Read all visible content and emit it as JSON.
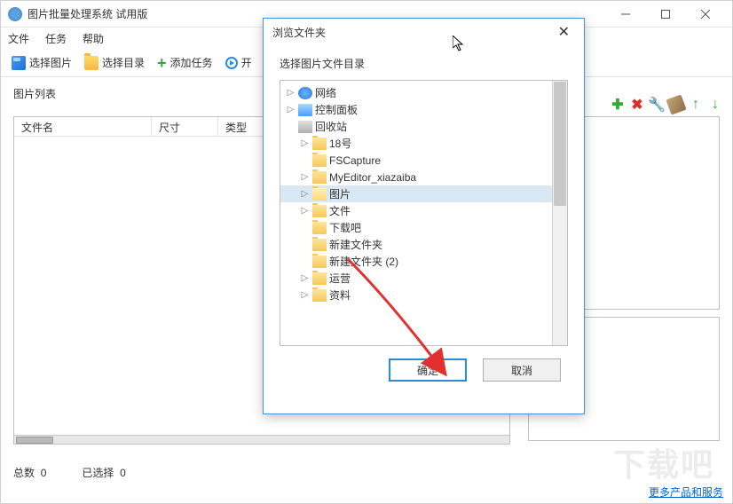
{
  "window": {
    "title": "图片批量处理系统 试用版"
  },
  "menu": {
    "file": "文件",
    "task": "任务",
    "help": "帮助"
  },
  "toolbar": {
    "select_image": "选择图片",
    "select_dir": "选择目录",
    "add_task": "添加任务",
    "start": "开"
  },
  "section": {
    "image_list": "图片列表"
  },
  "list": {
    "col_filename": "文件名",
    "col_size": "尺寸",
    "col_type": "类型"
  },
  "status": {
    "total_label": "总数",
    "total_value": "0",
    "selected_label": "已选择",
    "selected_value": "0"
  },
  "bottom_link": "更多产品和服务",
  "watermark": "下载吧",
  "dialog": {
    "title": "浏览文件夹",
    "subtitle": "选择图片文件目录",
    "ok": "确定",
    "cancel": "取消"
  },
  "tree": {
    "items": [
      {
        "label": "网络",
        "icon": "network",
        "expandable": true
      },
      {
        "label": "控制面板",
        "icon": "panel",
        "expandable": true
      },
      {
        "label": "回收站",
        "icon": "recycle",
        "expandable": false
      },
      {
        "label": "18号",
        "icon": "folder",
        "expandable": true
      },
      {
        "label": "FSCapture",
        "icon": "folder",
        "expandable": false
      },
      {
        "label": "MyEditor_xiazaiba",
        "icon": "folder",
        "expandable": true
      },
      {
        "label": "图片",
        "icon": "folder",
        "expandable": true,
        "selected": true
      },
      {
        "label": "文件",
        "icon": "folder",
        "expandable": true
      },
      {
        "label": "下载吧",
        "icon": "folder",
        "expandable": false
      },
      {
        "label": "新建文件夹",
        "icon": "folder",
        "expandable": false
      },
      {
        "label": "新建文件夹 (2)",
        "icon": "folder",
        "expandable": false
      },
      {
        "label": "运营",
        "icon": "folder",
        "expandable": true
      },
      {
        "label": "资料",
        "icon": "folder",
        "expandable": true
      }
    ]
  }
}
